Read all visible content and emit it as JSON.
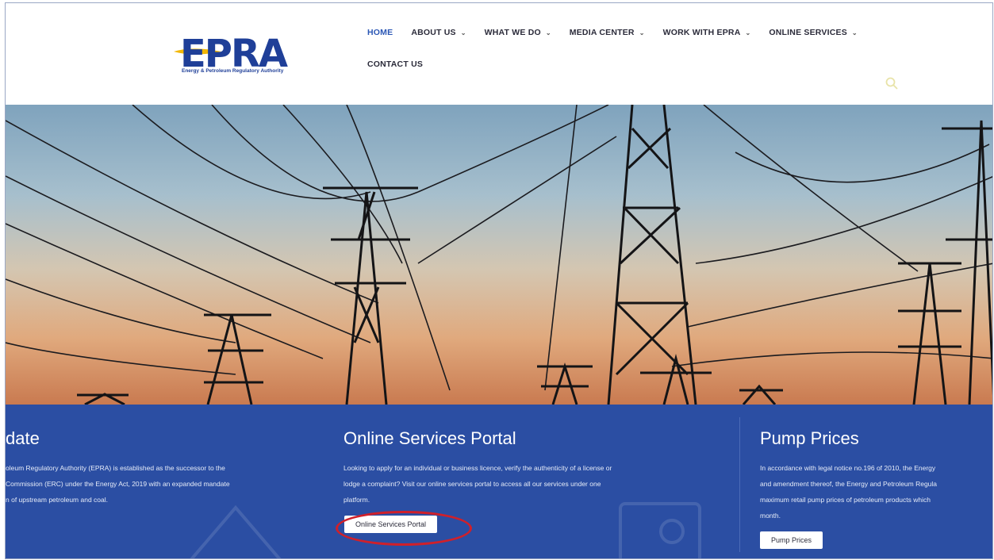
{
  "header": {
    "logo_text": "EPRA",
    "logo_subtitle": "Energy & Petroleum Regulatory Authority",
    "nav": [
      {
        "label": "HOME",
        "active": true,
        "dropdown": false
      },
      {
        "label": "ABOUT US",
        "active": false,
        "dropdown": true
      },
      {
        "label": "WHAT WE DO",
        "active": false,
        "dropdown": true
      },
      {
        "label": "MEDIA CENTER",
        "active": false,
        "dropdown": true
      },
      {
        "label": "WORK WITH EPRA",
        "active": false,
        "dropdown": true
      },
      {
        "label": "ONLINE SERVICES",
        "active": false,
        "dropdown": true
      }
    ],
    "nav_row2": {
      "label": "CONTACT US"
    },
    "search_icon": "search-icon"
  },
  "band": {
    "left": {
      "title": "date",
      "lines": [
        "oleum Regulatory Authority (EPRA) is established as the successor to the",
        "Commission (ERC) under the Energy Act, 2019 with an expanded mandate",
        "n of upstream petroleum and coal."
      ]
    },
    "middle": {
      "title": "Online Services Portal",
      "lines": [
        "Looking to apply for an individual or business licence, verify the authenticity of a license or",
        "lodge a complaint? Visit our online services portal to access all our services under one",
        "platform."
      ],
      "button": "Online Services Portal"
    },
    "right": {
      "title": "Pump Prices",
      "lines": [
        "In accordance with legal notice no.196 of 2010, the Energy",
        "and amendment thereof, the Energy and Petroleum Regula",
        "maximum retail pump prices of petroleum products which",
        "month."
      ],
      "button": "Pump Prices"
    }
  },
  "colors": {
    "accent": "#2b57b5",
    "band": "#2b4ea3",
    "highlight": "#d0202a",
    "logo": "#1f3f98"
  }
}
